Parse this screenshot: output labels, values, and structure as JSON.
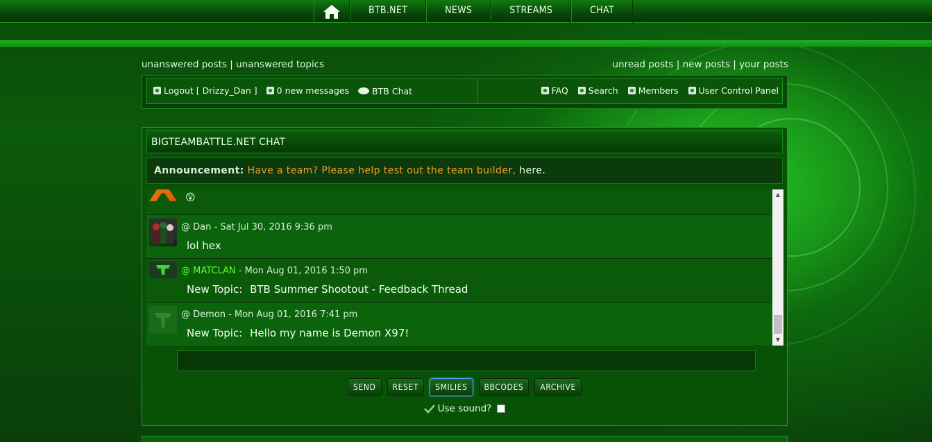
{
  "nav": {
    "items": [
      "BTB.NET",
      "NEWS",
      "STREAMS",
      "CHAT"
    ]
  },
  "links": {
    "unanswered_posts": "unanswered posts",
    "unanswered_topics": "unanswered topics",
    "unread_posts": "unread posts",
    "new_posts": "new posts",
    "your_posts": "your posts",
    "separator": "|"
  },
  "userbar": {
    "logout": "Logout [ Drizzy_Dan ]",
    "messages": "0 new messages",
    "chat": "BTB Chat",
    "faq": "FAQ",
    "search": "Search",
    "members": "Members",
    "ucp": "User Control Panel"
  },
  "chat": {
    "title": "BIGTEAMBATTLE.NET CHAT",
    "announcement_label": "Announcement:",
    "announcement_text": "Have a team? Please help test out the team builder,",
    "announcement_link": "here.",
    "messages": [
      {
        "user": "",
        "date": "",
        "body_label": "",
        "body": "😲",
        "avatar": "orange"
      },
      {
        "user": "Dan",
        "date": "Sat Jul 30, 2016 9:36 pm",
        "body_label": "",
        "body": "lol hex",
        "avatar": "group"
      },
      {
        "user": "MATCLAN",
        "date": "Mon Aug 01, 2016 1:50 pm",
        "body_label": "New Topic:",
        "body": "BTB Summer Shootout - Feedback Thread",
        "avatar": "logo-dark"
      },
      {
        "user": "Demon",
        "date": "Mon Aug 01, 2016 7:41 pm",
        "body_label": "New Topic:",
        "body": "Hello my name is Demon X97!",
        "avatar": "logo-green"
      }
    ],
    "at": "@",
    "dash": "-",
    "buttons": [
      "SEND",
      "RESET",
      "SMILIES",
      "BBCODES",
      "ARCHIVE"
    ],
    "sound_label": "Use sound?"
  }
}
